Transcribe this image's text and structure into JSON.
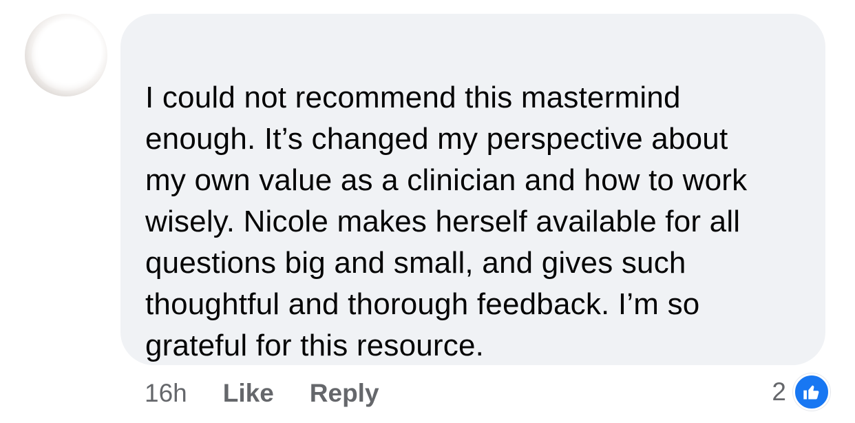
{
  "comment": {
    "text": "I could not recommend this mastermind\nenough. It’s changed my perspective about\nmy own value as a clinician and how to work\nwisely. Nicole makes herself available for all\nquestions big and small, and gives such\nthoughtful and thorough feedback. I’m so\ngrateful for this resource.",
    "timestamp": "16h",
    "like_label": "Like",
    "reply_label": "Reply",
    "reaction_count": "2",
    "reaction_icon": "thumbs-up-icon"
  },
  "colors": {
    "bubble_background": "#f0f2f5",
    "text": "#050505",
    "meta_text": "#65676b",
    "like_blue": "#1877f2"
  }
}
